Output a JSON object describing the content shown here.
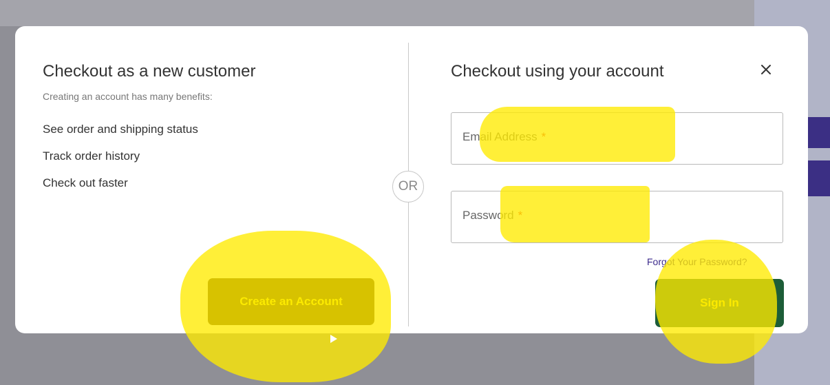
{
  "new_customer": {
    "title": "Checkout as a new customer",
    "subtitle": "Creating an account has many benefits:",
    "benefits": [
      "See order and shipping status",
      "Track order history",
      "Check out faster"
    ],
    "create_button_label": "Create an Account"
  },
  "separator": {
    "label": "OR"
  },
  "account": {
    "title": "Checkout using your account",
    "close_icon": "close-icon",
    "email": {
      "label": "Email Address",
      "required_mark": "*",
      "value": ""
    },
    "password": {
      "label": "Password",
      "required_mark": "*",
      "value": ""
    },
    "forgot_link": "Forgot Your Password?",
    "signin_button_label": "Sign In"
  },
  "colors": {
    "highlight": "#fff000",
    "button_text": "#f0e800",
    "create_button_bg": "#4a3300",
    "signin_button_bg": "#1d5d38",
    "link": "#3b2a8c",
    "required": "#e02424"
  }
}
